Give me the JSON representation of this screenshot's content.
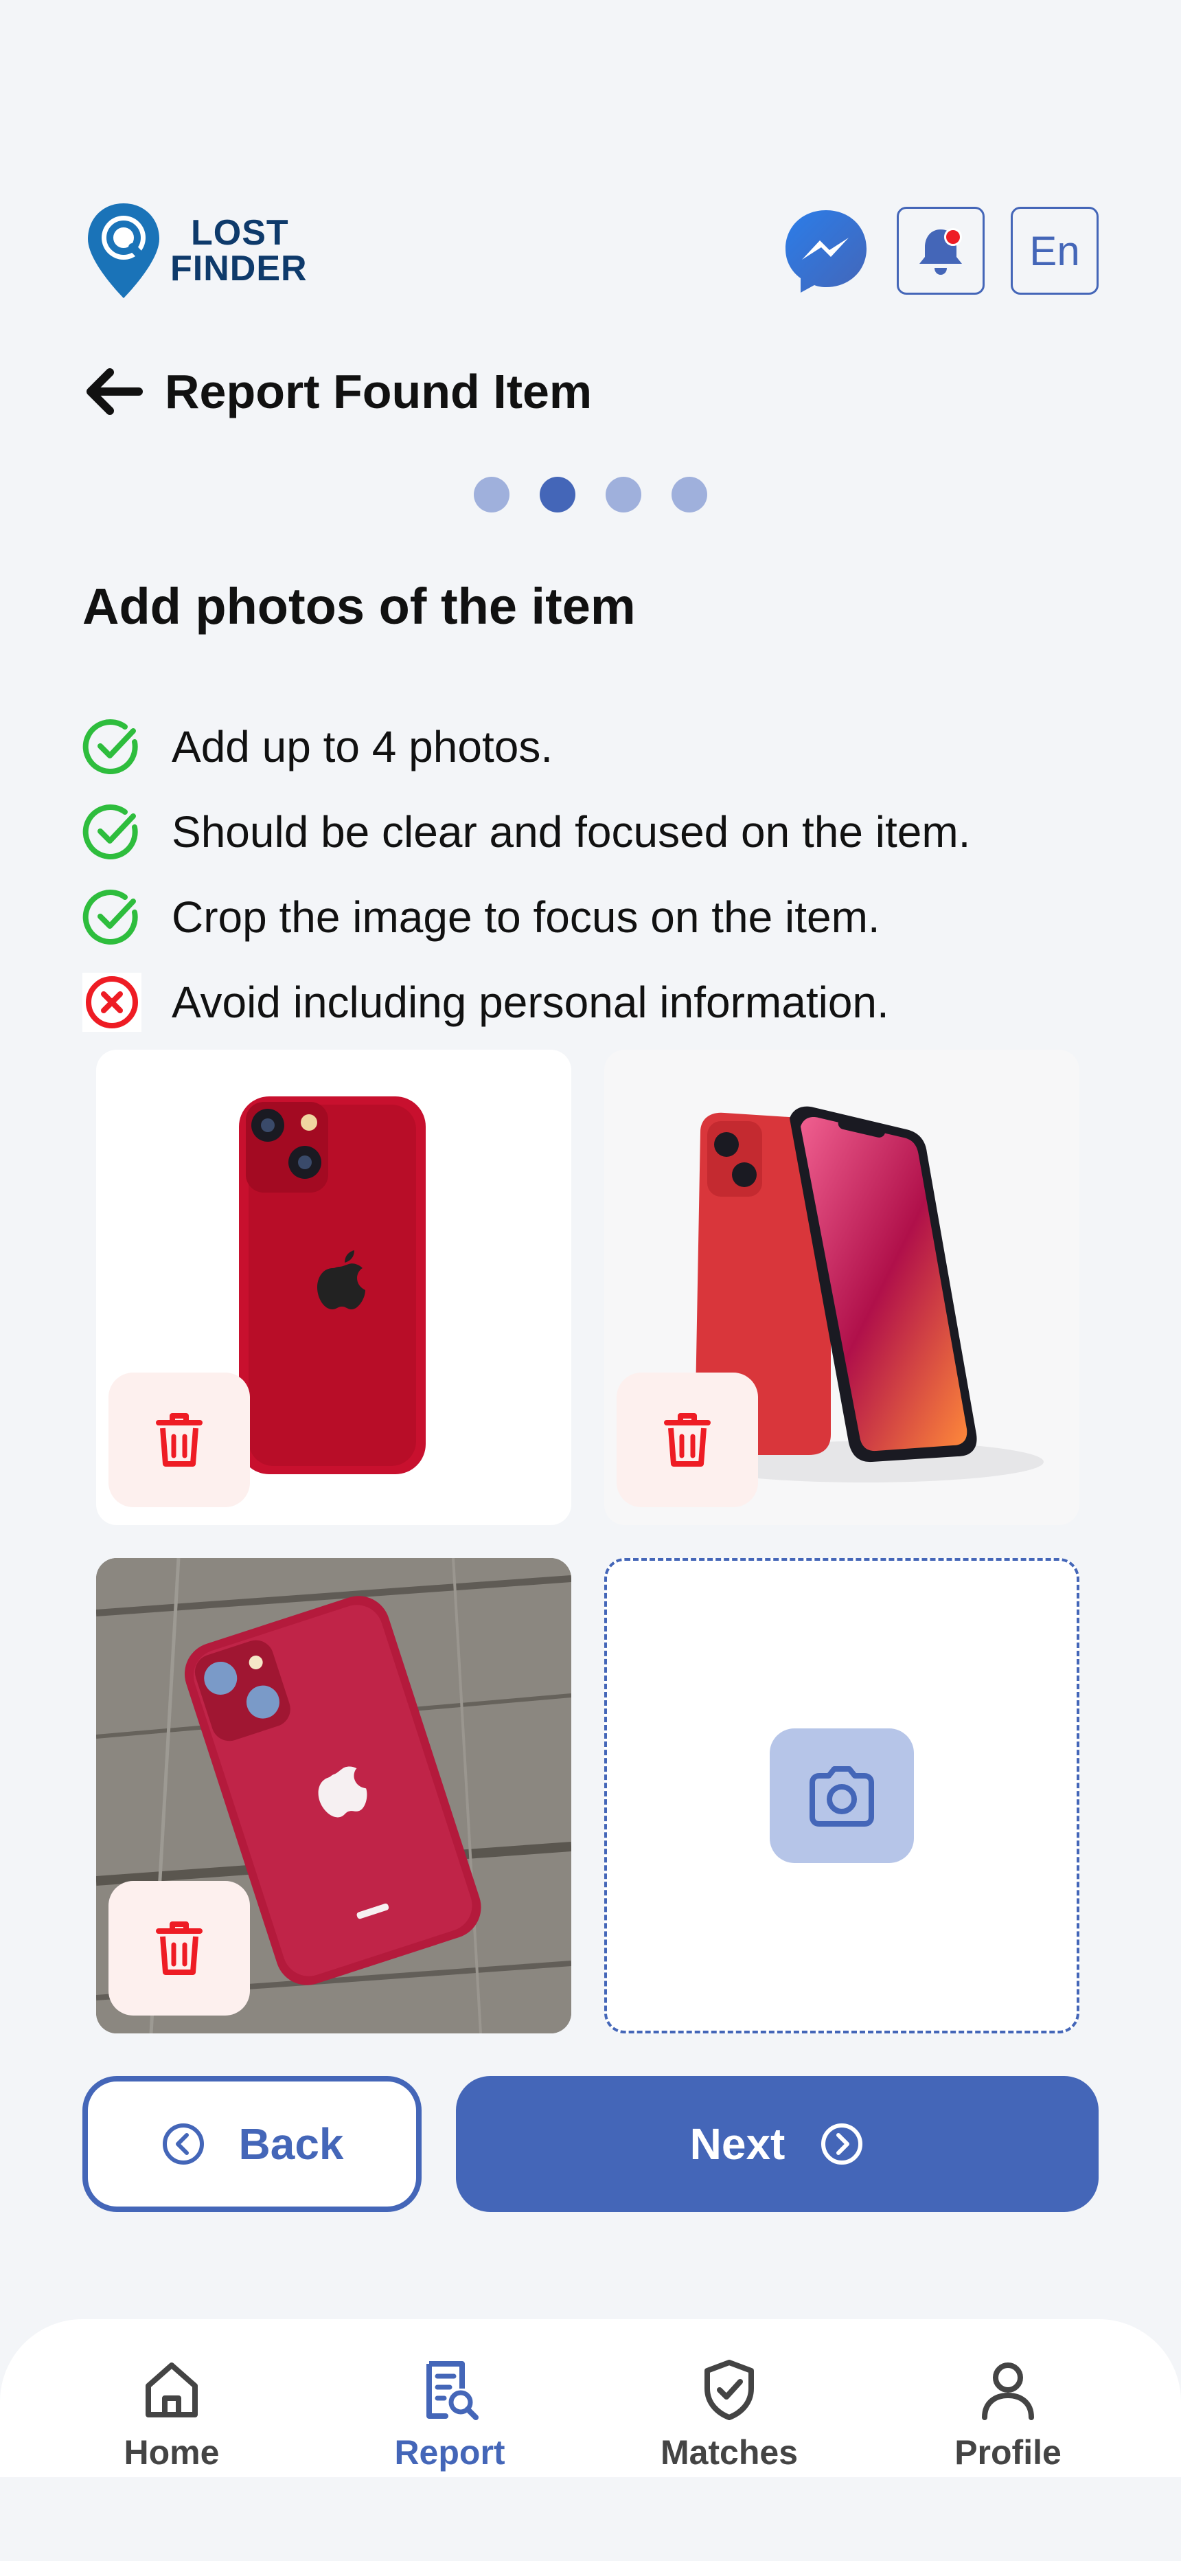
{
  "header": {
    "logo_line1": "LOST",
    "logo_line2": "FINDER",
    "language": "En",
    "notification_dot": true
  },
  "page": {
    "title": "Report Found Item",
    "steps_total": 4,
    "current_step": 2
  },
  "section": {
    "title": "Add photos  of the item",
    "guidelines": [
      {
        "text": "Add up to 4 photos.",
        "icon": "check-circle-icon",
        "ok": true
      },
      {
        "text": "Should be clear and focused on the item.",
        "icon": "check-circle-icon",
        "ok": true
      },
      {
        "text": "Crop the image to focus on the item.",
        "icon": "check-circle-icon",
        "ok": true
      },
      {
        "text": "Avoid including personal information.",
        "icon": "x-circle-icon",
        "ok": false
      }
    ]
  },
  "photos": {
    "uploaded": [
      {
        "subject": "red phone back view",
        "delete_icon": "trash-icon"
      },
      {
        "subject": "red phone front and back",
        "delete_icon": "trash-icon"
      },
      {
        "subject": "red phone on wooden table",
        "delete_icon": "trash-icon"
      }
    ],
    "add_slot_icon": "camera-icon"
  },
  "buttons": {
    "back_label": "Back",
    "next_label": "Next"
  },
  "nav": {
    "items": [
      {
        "label": "Home",
        "icon": "home-icon",
        "active": false
      },
      {
        "label": "Report",
        "icon": "report-icon",
        "active": true
      },
      {
        "label": "Matches",
        "icon": "shield-check-icon",
        "active": false
      },
      {
        "label": "Profile",
        "icon": "user-icon",
        "active": false
      }
    ]
  },
  "colors": {
    "primary": "#4466b8",
    "success": "#2ebd3d",
    "danger": "#ee1c24",
    "background": "#f3f5f8"
  }
}
